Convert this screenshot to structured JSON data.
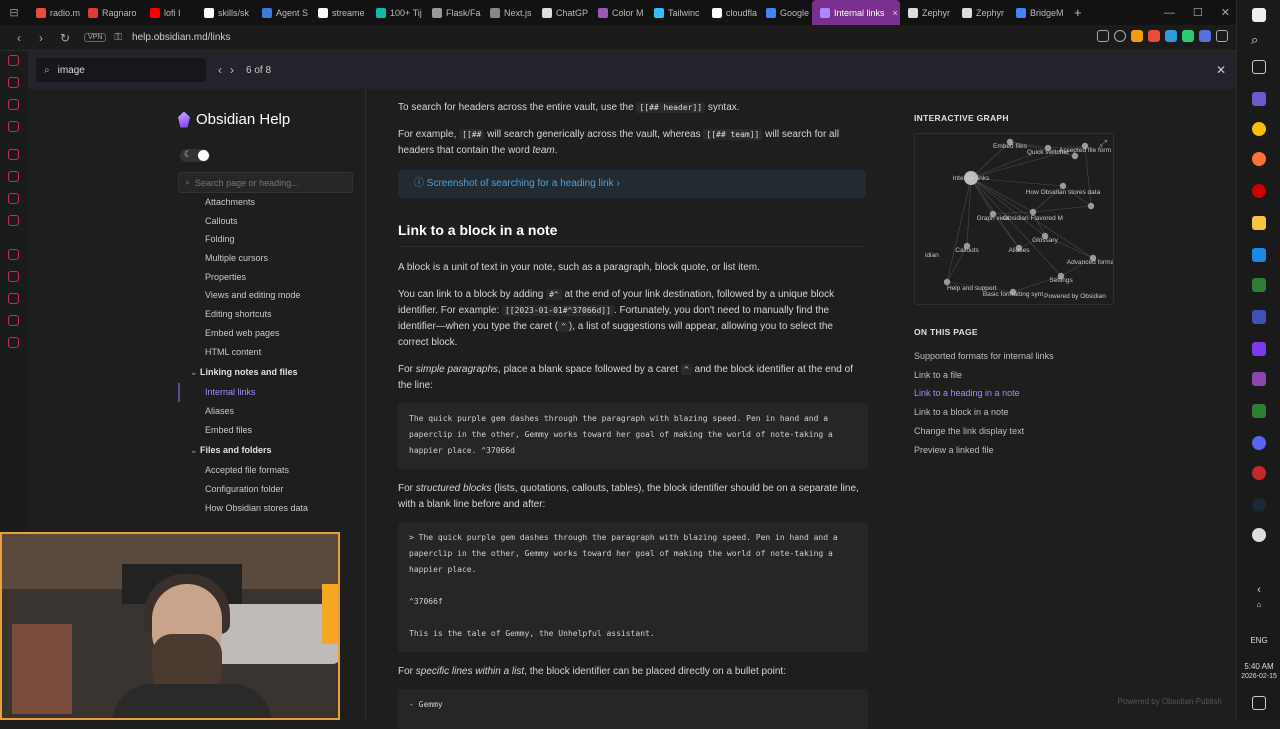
{
  "browser": {
    "tabs": [
      {
        "label": "radio.m",
        "color": "#e74c3c"
      },
      {
        "label": "Ragnaro",
        "color": "#e53935"
      },
      {
        "label": "lofi I",
        "color": "#ff0000"
      },
      {
        "label": "skills/sk",
        "color": "#ffffff"
      },
      {
        "label": "Agent S",
        "color": "#3d7bd9"
      },
      {
        "label": "streame",
        "color": "#ffffff"
      },
      {
        "label": "100+ Tij",
        "color": "#14b8a6"
      },
      {
        "label": "Flask/Fa",
        "color": "#999999"
      },
      {
        "label": "Next.js",
        "color": "#888888"
      },
      {
        "label": "ChatGP",
        "color": "#dddddd"
      },
      {
        "label": "Color M",
        "color": "#9b59b6"
      },
      {
        "label": "Tailwinc",
        "color": "#38bdf8"
      },
      {
        "label": "cloudfla",
        "color": "#ffffff"
      },
      {
        "label": "Google",
        "color": "#4285f4"
      },
      {
        "label": "Internal links",
        "color": "#a78bfa",
        "active": true
      },
      {
        "label": "Zephyr",
        "color": "#dddddd"
      },
      {
        "label": "Zephyr",
        "color": "#dddddd"
      },
      {
        "label": "BridgeM",
        "color": "#4285f4"
      }
    ],
    "new_tab": "+",
    "url": "help.obsidian.md/links",
    "vpn": "VPN"
  },
  "find": {
    "query": "image",
    "count": "6 of 8"
  },
  "site": {
    "logo": "Obsidian Help",
    "search_placeholder": "Search page or heading..."
  },
  "nav": {
    "items_top": [
      "Attachments",
      "Callouts",
      "Folding",
      "Multiple cursors",
      "Properties",
      "Views and editing mode",
      "Editing shortcuts",
      "Embed web pages",
      "HTML content"
    ],
    "group1": "Linking notes and files",
    "group1_items": [
      "Internal links",
      "Aliases",
      "Embed files"
    ],
    "group2": "Files and folders",
    "group2_items": [
      "Accepted file formats",
      "Configuration folder",
      "How Obsidian stores data"
    ]
  },
  "content": {
    "p1_a": "To search for headers across the entire vault, use the ",
    "p1_code": "[[## header]]",
    "p1_b": " syntax.",
    "p2_a": "For example, ",
    "p2_code1": "[[##",
    "p2_b": " will search generically across the vault, whereas ",
    "p2_code2": "[[## team]]",
    "p2_c": " will search for all headers that contain the word ",
    "p2_em": "team",
    "p2_d": ".",
    "callout": "Screenshot of searching for a heading link",
    "h2": "Link to a block in a note",
    "p3": "A block is a unit of text in your note, such as a paragraph, block quote, or list item.",
    "p4_a": "You can link to a block by adding ",
    "p4_code1": "#^",
    "p4_b": " at the end of your link destination, followed by a unique block identifier. For example: ",
    "p4_code2": "[[2023-01-01#^37066d]]",
    "p4_c": ". Fortunately, you don't need to manually find the identifier—when you type the caret (",
    "p4_code3": "^",
    "p4_d": "), a list of suggestions will appear, allowing you to select the correct block.",
    "p5_a": "For ",
    "p5_em": "simple paragraphs",
    "p5_b": ", place a blank space followed by a caret ",
    "p5_code": "^",
    "p5_c": " and the block identifier at the end of the line:",
    "code1": "The quick purple gem dashes through the paragraph with blazing speed. Pen in hand and a paperclip in the other, Gemmy works toward her goal of making the world of note-taking a happier place. ^37066d",
    "p6_a": "For ",
    "p6_em": "structured blocks",
    "p6_b": " (lists, quotations, callouts, tables), the block identifier should be on a separate line, with a blank line before and after:",
    "code2": "> The quick purple gem dashes through the paragraph with blazing speed. Pen in hand and a paperclip in the other, Gemmy works toward her goal of making the world of note-taking a happier place.\n\n^37066f\n\nThis is the tale of Gemmy, the Unhelpful assistant.",
    "p7_a": "For ",
    "p7_em": "specific lines within a list",
    "p7_b": ", the block identifier can be placed directly on a bullet point:",
    "code3": "- Gemmy"
  },
  "graph": {
    "title": "INTERACTIVE GRAPH",
    "labels": [
      "Embed files",
      "Quick switcher",
      "Accepted file form",
      "Internal links",
      "How Obsidian stores data",
      "Graph view",
      "Obsidian Flavored M",
      "idian",
      "Callouts",
      "Aliases",
      "Glossary",
      "Advanced formatti",
      "Settings",
      "Help and support",
      "Basic formatting synt",
      "Powered by Obsidian"
    ]
  },
  "toc": {
    "title": "ON THIS PAGE",
    "items": [
      "Supported formats for internal links",
      "Link to a file",
      "Link to a heading in a note",
      "Link to a block in a note",
      "Change the link display text",
      "Preview a linked file"
    ],
    "active_index": 2
  },
  "footer": "Powered by Obsidian Publish",
  "taskbar": {
    "lang": "ENG",
    "time": "5:40 AM",
    "date": "2026-02-15"
  },
  "colors": {
    "accent": "#a58bf5",
    "link": "#4aa3df",
    "bg": "#1e1e1e"
  }
}
